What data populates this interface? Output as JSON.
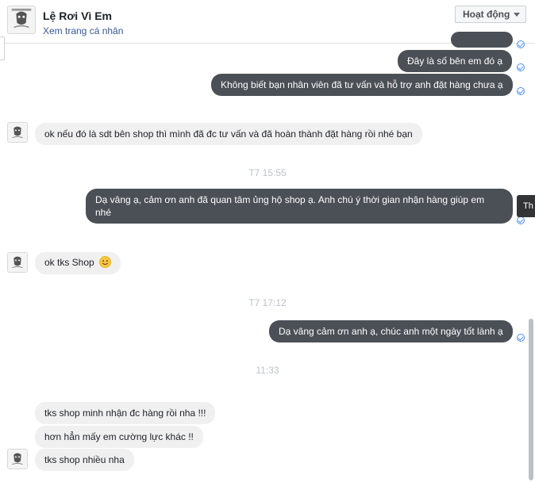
{
  "header": {
    "title": "Lệ Rơi Vì Em",
    "profile_link": "Xem trang cá nhân",
    "status_button": "Hoạt động"
  },
  "messages": {
    "m1": "Đây là số bên em đó ạ",
    "m2": "Không biết bạn nhân viên đã tư vấn và hỗ trợ anh đặt hàng chưa ạ",
    "m3": "ok nếu đó là sdt bên shop thì mình đã đc tư vấn và đã hoàn thành đặt hàng rồi nhé bạn",
    "m4_line1": "Dạ vâng ạ, cảm ơn anh đã quan tâm ủng hộ shop ạ. Anh chú ý thời gian nhận hàng giúp em",
    "m4_line2": "nhé",
    "m5": "ok tks Shop",
    "m6": "Dạ vâng cảm ơn anh ạ, chúc anh một ngày tốt lành ạ",
    "m7": "tks shop minh nhận đc hàng rồi nha !!!",
    "m8": "hơn hẳn mấy em cường lực khác !!",
    "m9": "tks shop nhiều nha"
  },
  "timestamps": {
    "t1": "T7 15:55",
    "t2": "T7 17:12",
    "t3": "11:33"
  },
  "tooltip": "Th",
  "colors": {
    "outgoing_bubble": "#4b4f56",
    "incoming_bubble": "#f1f0f0",
    "link": "#365899",
    "seen_check": "#4c8ef7"
  }
}
